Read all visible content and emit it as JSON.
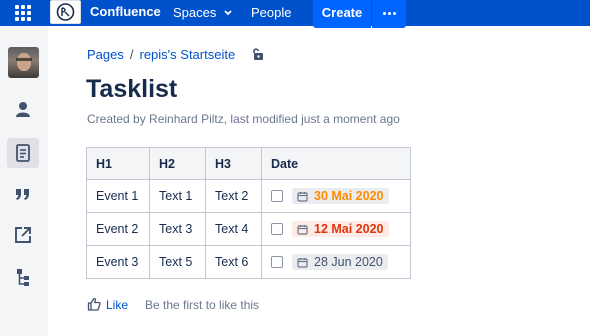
{
  "topnav": {
    "brand": "Confluence",
    "spaces_label": "Spaces",
    "people_label": "People",
    "create_label": "Create",
    "colors": {
      "bar": "#0052cc",
      "create": "#0065ff"
    },
    "icons": {
      "apps": "app-switcher-icon",
      "logo": "confluence-logo-icon",
      "more": "more-dots-icon",
      "spaces_menu": "chevron-down-icon"
    }
  },
  "sidebar": {
    "items": [
      {
        "name": "avatar",
        "icon": "profile-photo"
      },
      {
        "name": "profile",
        "icon": "person-icon"
      },
      {
        "name": "pages",
        "icon": "page-icon",
        "selected": true
      },
      {
        "name": "blog",
        "icon": "quote-icon"
      },
      {
        "name": "external",
        "icon": "external-link-icon"
      },
      {
        "name": "tree",
        "icon": "page-tree-icon"
      }
    ]
  },
  "breadcrumb": {
    "pages": "Pages",
    "sep": "/",
    "space": "repis's Startseite"
  },
  "page": {
    "title": "Tasklist",
    "byline": "Created by Reinhard Piltz, last modified just a moment ago"
  },
  "table": {
    "headers": [
      "H1",
      "H2",
      "H3",
      "Date"
    ],
    "rows": [
      {
        "h1": "Event 1",
        "h2": "Text 1",
        "h3": "Text 2",
        "date": "30 Mai 2020",
        "date_status": "upcoming",
        "checked": false
      },
      {
        "h1": "Event 2",
        "h2": "Text 3",
        "h3": "Text 4",
        "date": "12 Mai 2020",
        "date_status": "overdue",
        "checked": false
      },
      {
        "h1": "Event 3",
        "h2": "Text 5",
        "h3": "Text 6",
        "date": "28 Jun 2020",
        "date_status": "normal",
        "checked": false
      }
    ],
    "date_colors": {
      "upcoming": "#ff8b00",
      "overdue": "#de350b",
      "normal": "#42526e"
    }
  },
  "likes": {
    "like_label": "Like",
    "text": "Be the first to like this"
  }
}
